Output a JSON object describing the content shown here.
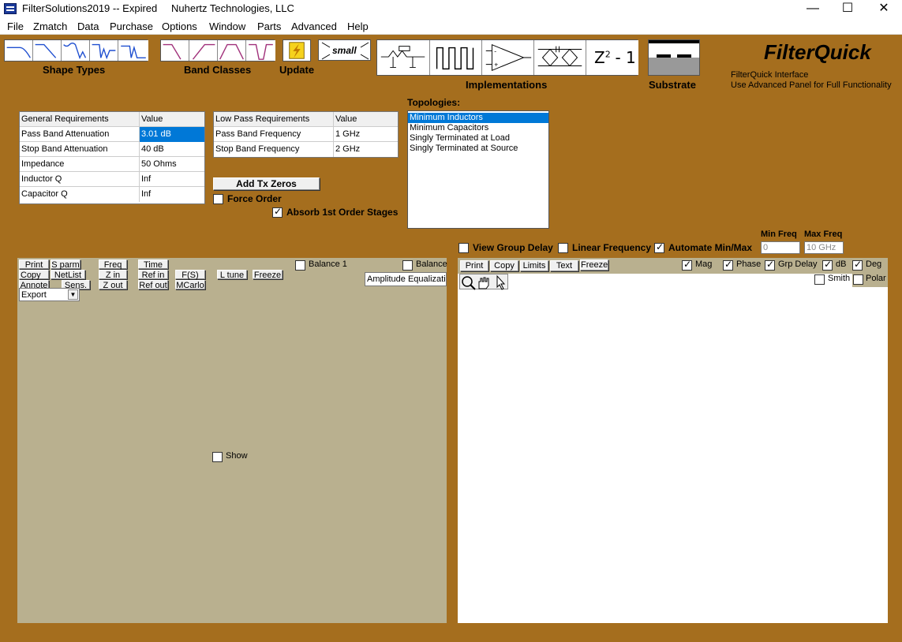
{
  "window": {
    "title": "FilterSolutions2019 -- Expired",
    "company": "Nuhertz Technologies, LLC",
    "min": "—",
    "max": "☐",
    "close": "✕"
  },
  "menu": [
    "File",
    "Zmatch",
    "Data",
    "Purchase",
    "Options",
    "Window",
    "Parts",
    "Advanced",
    "Help"
  ],
  "toolbar": {
    "shape_types_label": "Shape Types",
    "band_classes_label": "Band Classes",
    "update_label": "Update",
    "small_label": "small",
    "implementations_label": "Implementations",
    "substrate_label": "Substrate",
    "z_label": "Z",
    "z_sup": "2",
    "z_rest": "- 1"
  },
  "brand": {
    "title": "FilterQuick",
    "line1": "FilterQuick Interface",
    "line2": "Use Advanced Panel for Full  Functionality"
  },
  "general_requirements": {
    "header": [
      "General Requirements",
      "Value"
    ],
    "rows": [
      {
        "name": "Pass Band Attenuation",
        "value": "3.01 dB"
      },
      {
        "name": "Stop Band Attenuation",
        "value": "40 dB"
      },
      {
        "name": "Impedance",
        "value": "50 Ohms"
      },
      {
        "name": "Inductor Q",
        "value": "Inf"
      },
      {
        "name": "Capacitor Q",
        "value": "Inf"
      }
    ]
  },
  "low_pass_requirements": {
    "header": [
      "Low Pass Requirements",
      "Value"
    ],
    "rows": [
      {
        "name": "Pass Band Frequency",
        "value": "1 GHz"
      },
      {
        "name": "Stop Band Frequency",
        "value": "2 GHz"
      }
    ]
  },
  "controls": {
    "add_tx_zeros": "Add Tx Zeros",
    "force_order": "Force Order",
    "absorb": "Absorb 1st Order Stages"
  },
  "topologies": {
    "label": "Topologies:",
    "items": [
      "Minimum Inductors",
      "Minimum Capacitors",
      "Singly Terminated at Load",
      "Singly Terminated at Source"
    ]
  },
  "right_options": {
    "view_group_delay": "View Group Delay",
    "linear_frequency": "Linear Frequency",
    "automate": "Automate Min/Max",
    "min_freq_label": "Min Freq",
    "max_freq_label": "Max Freq",
    "min_freq_value": "0",
    "max_freq_value": "10 GHz"
  },
  "left_panel": {
    "print": "Print",
    "sparm": "S parm",
    "copy": "Copy",
    "netlist": "NetList",
    "annote": "Annote",
    "sens": "Sens.",
    "freq": "Freq",
    "zin": "Z in",
    "zout": "Z out",
    "time": "Time",
    "refin": "Ref in",
    "refout": "Ref out",
    "fs": "F(S)",
    "mcarlo": "MCarlo",
    "ltune": "L tune",
    "freeze": "Freeze",
    "export": "Export",
    "balance1": "Balance 1",
    "balance": "Balance",
    "amplitude": "Amplitude Equalizatio",
    "show": "Show"
  },
  "right_panel": {
    "print": "Print",
    "copy": "Copy",
    "limits": "Limits",
    "text": "Text",
    "freeze": "Freeze",
    "mag": "Mag",
    "phase": "Phase",
    "grp_delay": "Grp Delay",
    "db": "dB",
    "deg": "Deg",
    "smith": "Smith",
    "polar": "Polar"
  },
  "colors": {
    "background": "#a56e1e",
    "panel": "#b9b08f",
    "selection": "#0078d7",
    "curve_blue": "#1f4fd0",
    "curve_purple": "#a0307a"
  }
}
